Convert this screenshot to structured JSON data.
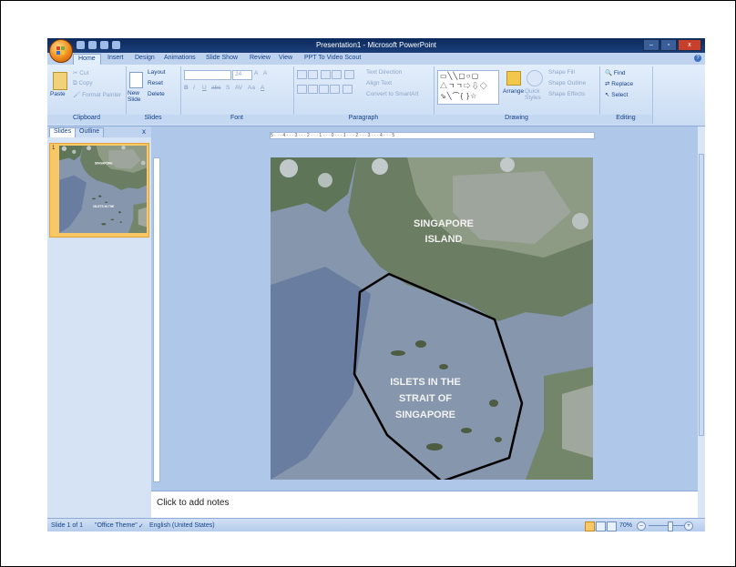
{
  "window": {
    "title": "Presentation1 - Microsoft PowerPoint",
    "minimize": "–",
    "maximize": "▫",
    "close": "x"
  },
  "tabs": [
    "Home",
    "Insert",
    "Design",
    "Animations",
    "Slide Show",
    "Review",
    "View",
    "PPT To Video Scout"
  ],
  "help": "?",
  "ribbon": {
    "clipboard": {
      "label": "Clipboard",
      "paste": "Paste",
      "cut": "Cut",
      "copy": "Copy",
      "format_painter": "Format Painter"
    },
    "slides": {
      "label": "Slides",
      "new_slide": "New Slide",
      "layout": "Layout",
      "reset": "Reset",
      "delete": "Delete"
    },
    "font": {
      "label": "Font",
      "size": "24",
      "grow": "A",
      "shrink": "A",
      "bold": "B",
      "italic": "I",
      "underline": "U",
      "strike": "abc",
      "shadow": "S",
      "spacing": "AV",
      "case": "Aa",
      "color": "A"
    },
    "paragraph": {
      "label": "Paragraph",
      "text_direction": "Text Direction",
      "align_text": "Align Text",
      "smartart": "Convert to SmartArt"
    },
    "drawing": {
      "label": "Drawing",
      "shapes_row1": "▭╲╲▢○▢",
      "shapes_row2": "△ㄱㄱ⇨⇩◇",
      "shapes_row3": "⇘╲⌒{ }☆",
      "arrange": "Arrange",
      "quick_styles": "Quick Styles",
      "shape_fill": "Shape Fill",
      "shape_outline": "Shape Outline",
      "shape_effects": "Shape Effects"
    },
    "editing": {
      "label": "Editing",
      "find": "Find",
      "replace": "Replace",
      "select": "Select"
    }
  },
  "panes": {
    "slides_tab": "Slides",
    "outline_tab": "Outline",
    "close": "x",
    "thumb_number": "1"
  },
  "ruler_text": "5 · · · 4 · · · 3 · · · 2 · · · 1 · · · 0 · · · 1 · · · 2 · · · 3 · · · 4 · · · 5",
  "slide": {
    "island_label_line1": "SINGAPORE",
    "island_label_line2": "ISLAND",
    "islets_line1": "ISLETS IN THE",
    "islets_line2": "STRAIT OF",
    "islets_line3": "SINGAPORE"
  },
  "notes_placeholder": "Click to add notes",
  "status": {
    "slide": "Slide 1 of 1",
    "theme": "\"Office Theme\"",
    "language": "English (United States)",
    "zoom": "70%",
    "zoom_out": "–",
    "zoom_in": "+"
  }
}
